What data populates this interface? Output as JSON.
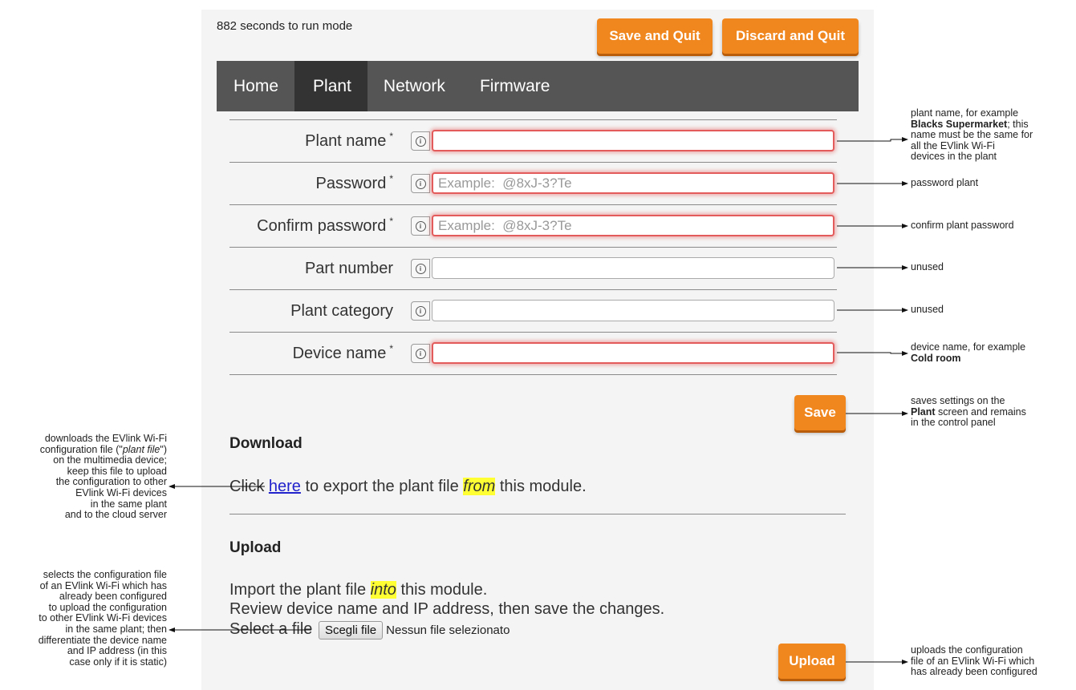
{
  "header": {
    "countdown": "882 seconds to run mode",
    "save_quit_label": "Save and Quit",
    "discard_quit_label": "Discard and Quit"
  },
  "nav": {
    "tabs": [
      {
        "label": "Home",
        "active": false
      },
      {
        "label": "Plant",
        "active": true
      },
      {
        "label": "Network",
        "active": false
      },
      {
        "label": "Firmware",
        "active": false
      }
    ]
  },
  "form": {
    "required_mark": "*",
    "fields": [
      {
        "label": "Plant name",
        "required": true,
        "value": "",
        "placeholder": ""
      },
      {
        "label": "Password",
        "required": true,
        "value": "",
        "placeholder": "Example:  @8xJ-3?Te"
      },
      {
        "label": "Confirm password",
        "required": true,
        "value": "",
        "placeholder": "Example:  @8xJ-3?Te"
      },
      {
        "label": "Part number",
        "required": false,
        "value": "",
        "placeholder": ""
      },
      {
        "label": "Plant category",
        "required": false,
        "value": "",
        "placeholder": ""
      },
      {
        "label": "Device name",
        "required": true,
        "value": "",
        "placeholder": ""
      }
    ],
    "info_icon_glyph": "i",
    "save_label": "Save"
  },
  "download": {
    "heading": "Download",
    "text_before": "Click ",
    "link": "here",
    "text_middle": " to export the plant file ",
    "highlight": "from",
    "text_after": " this module."
  },
  "upload": {
    "heading": "Upload",
    "line1_before": "Import the plant file ",
    "line1_highlight": "into",
    "line1_after": " this module.",
    "line2": "Review device name and IP address, then save the changes.",
    "select_label": "Select a file",
    "choose_button": "Scegli file",
    "no_file": "Nessun file selezionato",
    "upload_label": "Upload"
  },
  "annotations": {
    "plant_name_1": "plant name, for example",
    "plant_name_2": "Blacks Supermarket",
    "plant_name_3": "; this",
    "plant_name_4": "name must be the same for",
    "plant_name_5": "all the EVlink Wi-Fi",
    "plant_name_6": "devices in the plant",
    "password": "password plant",
    "confirm": "confirm plant password",
    "part_number": "unused",
    "plant_category": "unused",
    "device_name_1": "device name, for example",
    "device_name_2": "Cold room",
    "save_1": "saves settings on the",
    "save_2a": "Plant",
    "save_2b": " screen and remains",
    "save_3": "in the control panel",
    "download_1": "downloads the EVlink Wi-Fi",
    "download_2": "configuration file (\"",
    "download_2i": "plant file",
    "download_2e": "\")",
    "download_3": "on the multimedia device;",
    "download_4": "keep this file to upload",
    "download_5": "the configuration to other",
    "download_6": "EVlink Wi-Fi devices",
    "download_7": "in the same plant",
    "download_8": "and to the cloud server",
    "select_1": "selects the configuration file",
    "select_2": "of an EVlink Wi-Fi which has",
    "select_3": "already been configured",
    "select_4": "to upload the configuration",
    "select_5": "to other EVlink Wi-Fi devices",
    "select_6": "in the same plant; then",
    "select_7": "differentiate the device name",
    "select_8": "and IP address (in this",
    "select_9": "case only if it is static)",
    "upload_1": "uploads the configuration",
    "upload_2": "file of an EVlink Wi-Fi which",
    "upload_3": "has already been configured"
  },
  "colors": {
    "accent": "#f0861e",
    "nav_bg": "#555555",
    "nav_active": "#333333",
    "required_glow": "#e45b5b",
    "highlight": "#ffff33"
  }
}
